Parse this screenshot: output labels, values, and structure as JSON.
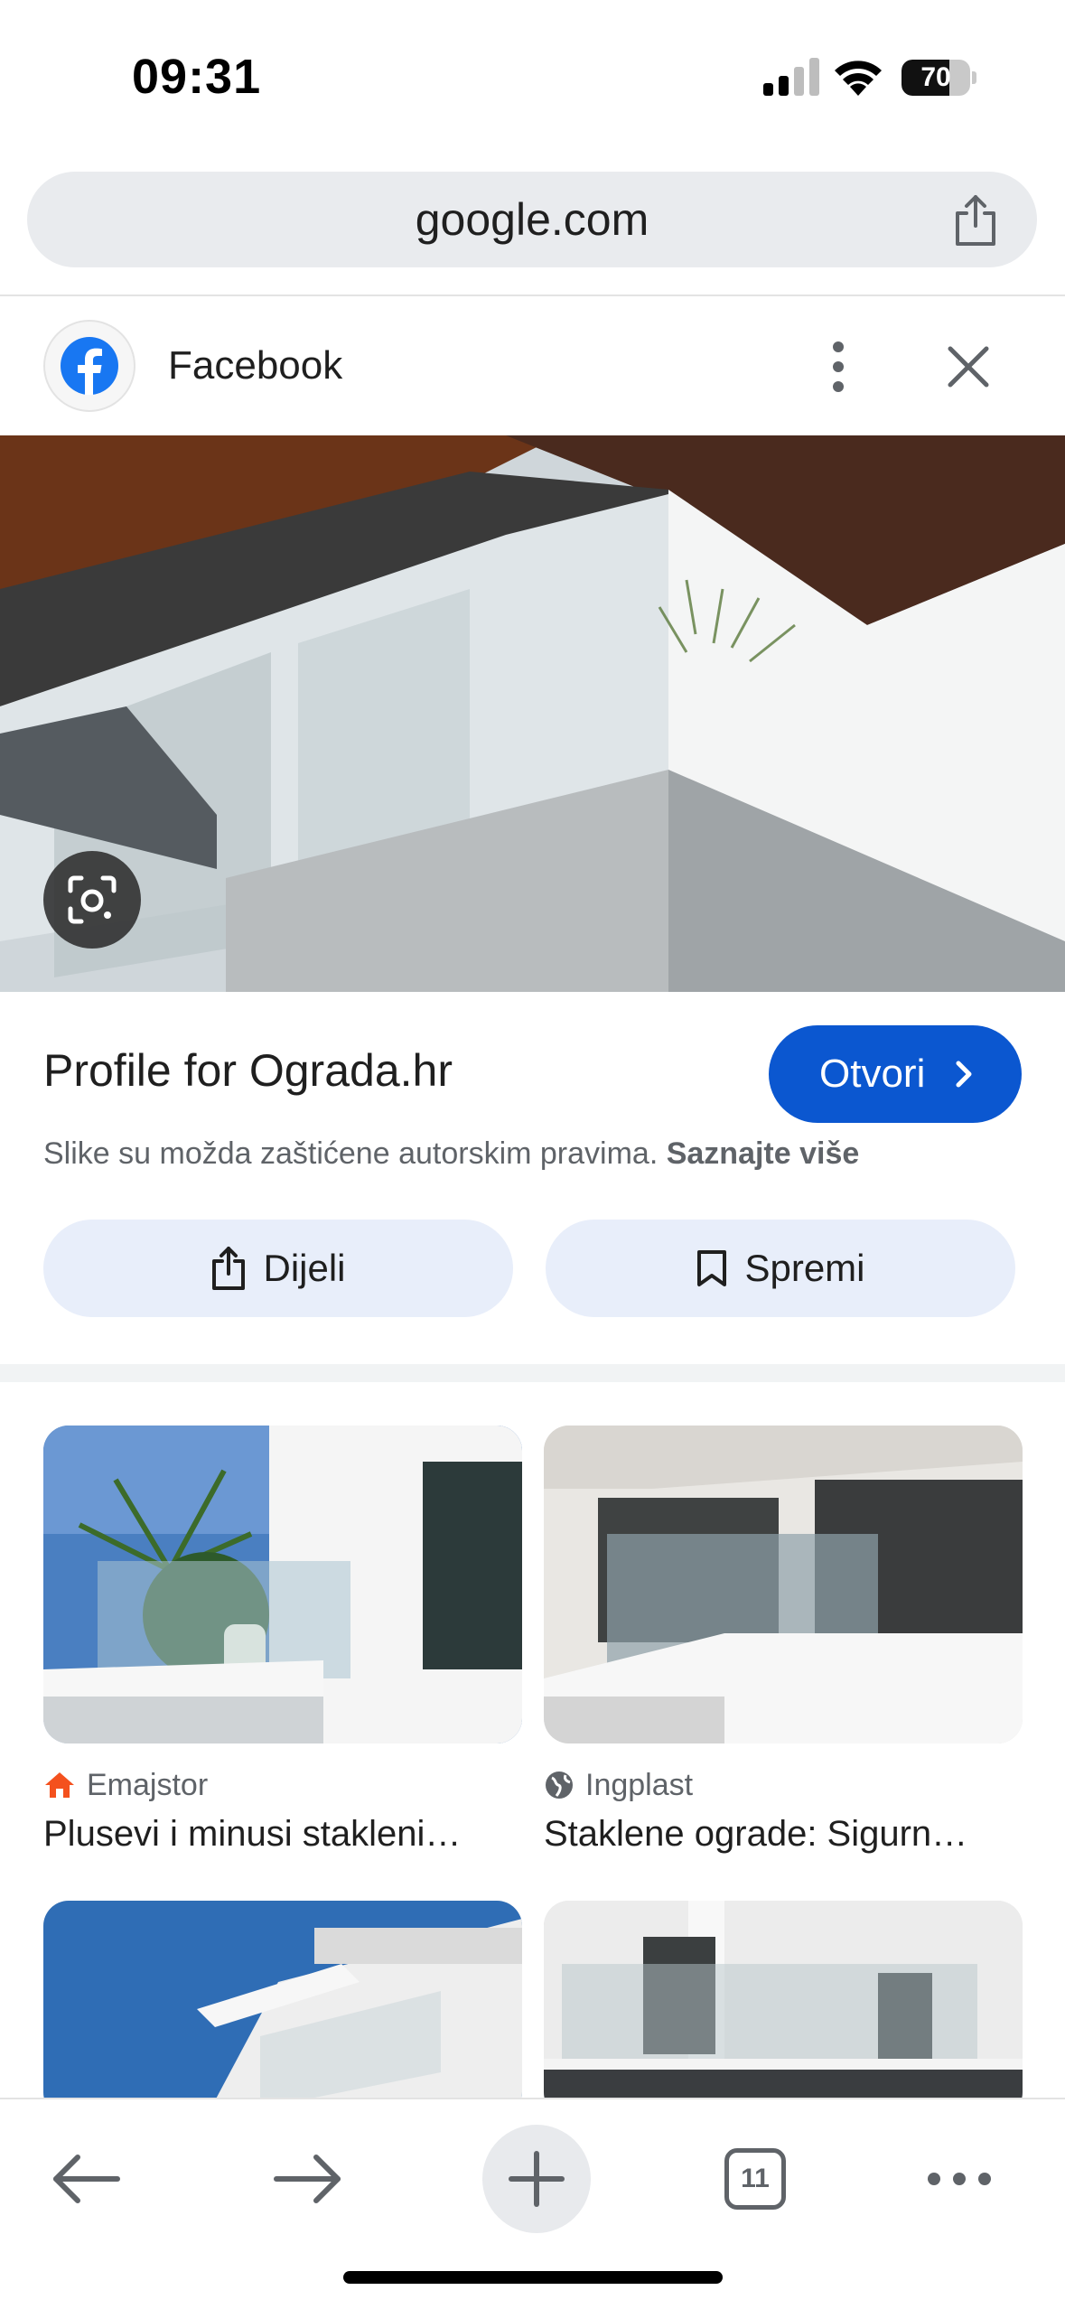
{
  "status_bar": {
    "time": "09:31",
    "battery_level": 70,
    "battery_label": "70"
  },
  "browser": {
    "url": "google.com"
  },
  "source": {
    "name": "Facebook"
  },
  "result": {
    "title": "Profile for Ograda.hr",
    "open_label": "Otvori",
    "copyright_text": "Slike su možda zaštićene autorskim pravima.",
    "learn_more": "Saznajte više",
    "share_label": "Dijeli",
    "save_label": "Spremi"
  },
  "related": [
    {
      "source": "Emajstor",
      "title": "Plusevi i minusi stakleni…",
      "source_icon": "home-icon"
    },
    {
      "source": "Ingplast",
      "title": "Staklene ograde: Sigurn…",
      "source_icon": "globe-icon"
    }
  ],
  "toolbar": {
    "tab_count": "11"
  },
  "colors": {
    "accent": "#0b57d0",
    "tonal_button": "#e8eefa",
    "facebook": "#1877f2",
    "emajstor": "#f4511e"
  }
}
